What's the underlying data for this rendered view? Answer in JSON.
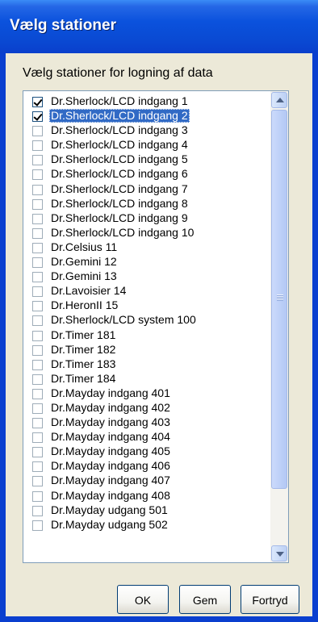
{
  "window": {
    "title": "Vælg stationer"
  },
  "prompt": "Vælg stationer for logning af data",
  "stations": [
    {
      "label": "Dr.Sherlock/LCD indgang 1",
      "checked": true
    },
    {
      "label": "Dr.Sherlock/LCD indgang 2",
      "checked": true,
      "selected": true
    },
    {
      "label": "Dr.Sherlock/LCD indgang 3",
      "checked": false
    },
    {
      "label": "Dr.Sherlock/LCD indgang 4",
      "checked": false
    },
    {
      "label": "Dr.Sherlock/LCD indgang 5",
      "checked": false
    },
    {
      "label": "Dr.Sherlock/LCD indgang 6",
      "checked": false
    },
    {
      "label": "Dr.Sherlock/LCD indgang 7",
      "checked": false
    },
    {
      "label": "Dr.Sherlock/LCD indgang 8",
      "checked": false
    },
    {
      "label": "Dr.Sherlock/LCD indgang 9",
      "checked": false
    },
    {
      "label": "Dr.Sherlock/LCD indgang 10",
      "checked": false
    },
    {
      "label": "Dr.Celsius 11",
      "checked": false
    },
    {
      "label": "Dr.Gemini 12",
      "checked": false
    },
    {
      "label": "Dr.Gemini 13",
      "checked": false
    },
    {
      "label": "Dr.Lavoisier 14",
      "checked": false
    },
    {
      "label": "Dr.HeronII 15",
      "checked": false
    },
    {
      "label": "Dr.Sherlock/LCD system 100",
      "checked": false
    },
    {
      "label": "Dr.Timer 181",
      "checked": false
    },
    {
      "label": "Dr.Timer 182",
      "checked": false
    },
    {
      "label": "Dr.Timer 183",
      "checked": false
    },
    {
      "label": "Dr.Timer 184",
      "checked": false
    },
    {
      "label": "Dr.Mayday indgang 401",
      "checked": false
    },
    {
      "label": "Dr.Mayday indgang 402",
      "checked": false
    },
    {
      "label": "Dr.Mayday indgang 403",
      "checked": false
    },
    {
      "label": "Dr.Mayday indgang 404",
      "checked": false
    },
    {
      "label": "Dr.Mayday indgang 405",
      "checked": false
    },
    {
      "label": "Dr.Mayday indgang 406",
      "checked": false
    },
    {
      "label": "Dr.Mayday indgang 407",
      "checked": false
    },
    {
      "label": "Dr.Mayday indgang 408",
      "checked": false
    },
    {
      "label": "Dr.Mayday udgang 501",
      "checked": false
    },
    {
      "label": "Dr.Mayday udgang 502",
      "checked": false
    }
  ],
  "buttons": {
    "ok": "OK",
    "save": "Gem",
    "cancel": "Fortryd"
  },
  "colors": {
    "titlebar": "#0a4ad3",
    "selection": "#316ac5",
    "dialog": "#ece9d8"
  }
}
